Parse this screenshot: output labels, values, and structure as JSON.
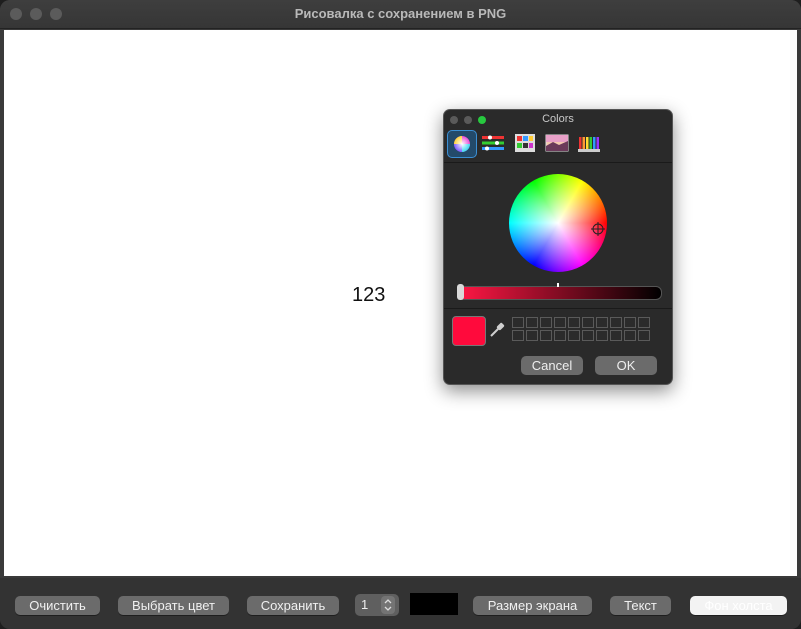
{
  "window": {
    "title": "Рисовалка с сохранением в PNG"
  },
  "canvas": {
    "text": "123",
    "background": "#ffffff"
  },
  "toolbar": {
    "clear_label": "Очистить",
    "pick_color_label": "Выбрать цвет",
    "save_label": "Сохранить",
    "brush_size_value": "1",
    "current_color": "#000000",
    "screen_size_label": "Размер экрана",
    "text_label": "Текст",
    "canvas_bg_label": "Фон холста"
  },
  "color_panel": {
    "title": "Colors",
    "tabs": [
      "color-wheel",
      "color-sliders",
      "color-palettes",
      "image-palettes",
      "pencils"
    ],
    "selected_tab": "color-wheel",
    "selected_color": "#ff0a3c",
    "cancel_label": "Cancel",
    "ok_label": "OK"
  }
}
